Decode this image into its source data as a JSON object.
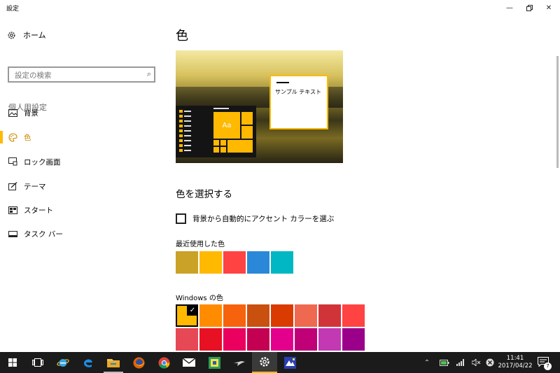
{
  "window": {
    "title": "設定",
    "minimize_icon": "minimize-icon",
    "maximize_icon": "restore-icon",
    "close_icon": "close-icon"
  },
  "sidebar": {
    "home_label": "ホーム",
    "search_placeholder": "設定の検索",
    "section_header": "個人用設定",
    "items": [
      {
        "label": "背景",
        "icon": "picture-icon",
        "active": false
      },
      {
        "label": "色",
        "icon": "palette-icon",
        "active": true
      },
      {
        "label": "ロック画面",
        "icon": "lock-screen-icon",
        "active": false
      },
      {
        "label": "テーマ",
        "icon": "paintbrush-icon",
        "active": false
      },
      {
        "label": "スタート",
        "icon": "start-tiles-icon",
        "active": false
      },
      {
        "label": "タスク バー",
        "icon": "taskbar-icon",
        "active": false
      }
    ]
  },
  "main": {
    "title": "色",
    "preview": {
      "tile_label": "Aa",
      "sample_text": "サンプル テキスト"
    },
    "choose_color_heading": "色を選択する",
    "auto_accent_label": "背景から自動的にアクセント カラーを選ぶ",
    "auto_accent_checked": false,
    "recent_colors_label": "最近使用した色",
    "recent_colors": [
      "#c9a227",
      "#ffb900",
      "#ff4343",
      "#2b88d8",
      "#00b7c3"
    ],
    "windows_colors_label": "Windows の色",
    "windows_colors_row1": [
      "#ffb900",
      "#ff8c00",
      "#f7630c",
      "#ca5010",
      "#da3b01",
      "#ef6950",
      "#d13438",
      "#ff4343"
    ],
    "windows_colors_row2": [
      "#e74856",
      "#e81123",
      "#ea005e",
      "#c30052",
      "#e3008c",
      "#bf0077",
      "#c239b3",
      "#9a0089"
    ],
    "selected_windows_color": "#ffb900",
    "accent_color": "#ffb900"
  },
  "taskbar": {
    "apps": [
      {
        "name": "start-button",
        "icon": "windows-logo-icon"
      },
      {
        "name": "task-view-button",
        "icon": "task-view-icon"
      },
      {
        "name": "internet-explorer-button",
        "icon": "internet-explorer-icon"
      },
      {
        "name": "edge-button",
        "icon": "edge-icon"
      },
      {
        "name": "file-explorer-button",
        "icon": "folder-icon"
      },
      {
        "name": "firefox-button",
        "icon": "firefox-icon"
      },
      {
        "name": "chrome-button",
        "icon": "chrome-icon"
      },
      {
        "name": "mail-button",
        "icon": "mail-icon"
      },
      {
        "name": "store-app-button",
        "icon": "app-tile-icon"
      },
      {
        "name": "game-app-button",
        "icon": "jet-icon"
      },
      {
        "name": "settings-button",
        "icon": "gear-icon"
      },
      {
        "name": "image-app-button",
        "icon": "image-app-icon"
      }
    ],
    "time": "11:41",
    "date": "2017/04/22",
    "notification_count": "7"
  }
}
